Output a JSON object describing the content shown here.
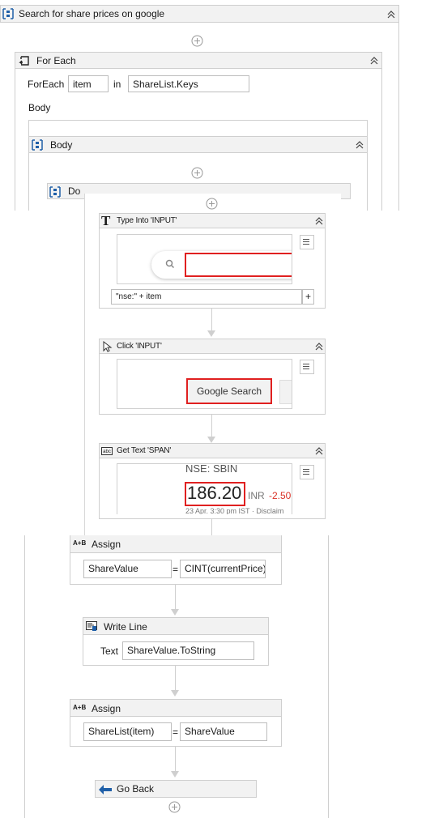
{
  "sequence": {
    "title": "Search for share prices on google"
  },
  "foreach": {
    "title": "For Each",
    "foreach_label": "ForEach",
    "item_value": "item",
    "in_label": "in",
    "collection_value": "ShareList.Keys",
    "body_label": "Body"
  },
  "body_seq": {
    "title": "Body"
  },
  "do_seq": {
    "title": "Do"
  },
  "type_into": {
    "title": "Type Into 'INPUT'",
    "text_value": "\"nse:\" + item",
    "add_label": "+"
  },
  "click": {
    "title": "Click 'INPUT'",
    "preview_button": "Google Search"
  },
  "get_text": {
    "title": "Get Text 'SPAN'",
    "preview_exchange": "NSE: SBIN",
    "preview_price": "186.20",
    "preview_currency": "INR",
    "preview_change": "-2.50",
    "preview_date": "23 Apr. 3:30 pm IST · Disclaim"
  },
  "assign1": {
    "title": "Assign",
    "icon_text": "A+B",
    "to_value": "ShareValue",
    "eq": "=",
    "value": "CINT(currentPrice)"
  },
  "write_line": {
    "title": "Write Line",
    "text_label": "Text",
    "text_value": "ShareValue.ToString"
  },
  "assign2": {
    "title": "Assign",
    "icon_text": "A+B",
    "to_value": "ShareList(item)",
    "eq": "=",
    "value": "ShareValue"
  },
  "go_back": {
    "title": "Go Back"
  }
}
